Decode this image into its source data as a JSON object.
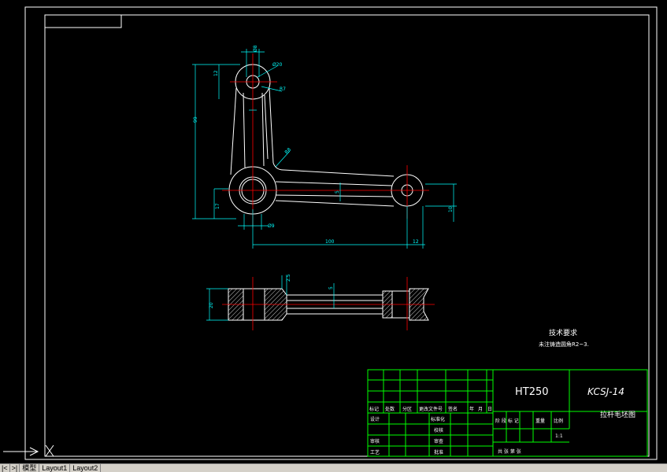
{
  "drawing": {
    "material": "HT250",
    "drawing_code": "KCSJ-14",
    "part_name": "拉杆毛坯图",
    "tech_req_title": "技术要求",
    "tech_req_line": "未注铸造圆角R2~3."
  },
  "dimensions": {
    "d_top_outer": "Ø8",
    "d_top_hole": "Ø20",
    "r_top": "R7",
    "h_top_boss": "12",
    "total_height": "99",
    "fillet": "R8",
    "web_thickness": "5",
    "h_bottom": "17",
    "d_bottom_hole": "Ø9",
    "length": "100",
    "end_len": "12",
    "offset": "10",
    "section_depth": "2.5",
    "section_web": "5",
    "section_height": "20"
  },
  "title_block": {
    "headers": [
      "标记",
      "处数",
      "分区",
      "更改文件号",
      "签名",
      "年",
      "月",
      "日"
    ],
    "role_design": "设计",
    "role_standard": "标准化",
    "role_review": "审核",
    "role_process": "工艺",
    "role_check": "校核",
    "role_approve": "批准",
    "role_audit": "审查",
    "stage_label": "阶 段 标 记",
    "weight_label": "重量",
    "scale_label": "比例",
    "scale_value": "1:1",
    "sheets_label": "共    张  第    张"
  },
  "ucs": {
    "x_label": "X"
  },
  "tabs": [
    "模型",
    "Layout1",
    "Layout2"
  ],
  "colors": {
    "background": "#000000",
    "outline": "#ffffff",
    "centerline": "#ff0000",
    "dimension": "#00ffff",
    "titleblock": "#00ff00"
  }
}
